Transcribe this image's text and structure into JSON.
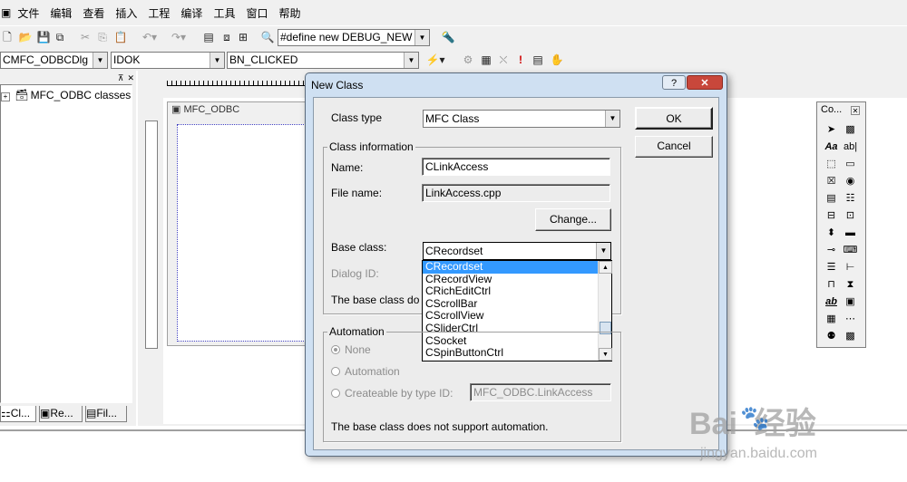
{
  "menu": [
    "文件",
    "编辑",
    "查看",
    "插入",
    "工程",
    "编译",
    "工具",
    "窗口",
    "帮助"
  ],
  "toolbar": {
    "define_combo": "#define new DEBUG_NEW",
    "class_combo": "CMFC_ODBCDlg",
    "id_combo": "IDOK",
    "msg_combo": "BN_CLICKED"
  },
  "workspace": {
    "tree_root": "MFC_ODBC classes",
    "tabs": [
      "Cl...",
      "Re...",
      "Fil..."
    ]
  },
  "editor": {
    "dialog_title": "MFC_ODBC"
  },
  "controls_palette": {
    "title": "Co..."
  },
  "dialog": {
    "title": "New Class",
    "help": "?",
    "class_type_label": "Class type",
    "class_type_value": "MFC Class",
    "ok": "OK",
    "cancel": "Cancel",
    "class_info_label": "Class information",
    "name_label": "Name:",
    "name_value": "CLinkAccess",
    "filename_label": "File name:",
    "filename_value": "LinkAccess.cpp",
    "change": "Change...",
    "base_class_label": "Base class:",
    "base_class_value": "CRecordset",
    "dialog_id_label": "Dialog ID:",
    "base_note": "The base class do",
    "base_options": [
      "CRecordset",
      "CRecordView",
      "CRichEditCtrl",
      "CScrollBar",
      "CScrollView",
      "CSliderCtrl",
      "CSocket",
      "CSpinButtonCtrl"
    ],
    "selected_option": "CRecordset",
    "automation_label": "Automation",
    "auto_none": "None",
    "auto_automation": "Automation",
    "auto_createable": "Createable by type ID:",
    "type_id_value": "MFC_ODBC.LinkAccess",
    "auto_note": "The base class does not support automation."
  },
  "watermark": {
    "brand": "Bai  经验",
    "url": "jingyan.baidu.com"
  }
}
